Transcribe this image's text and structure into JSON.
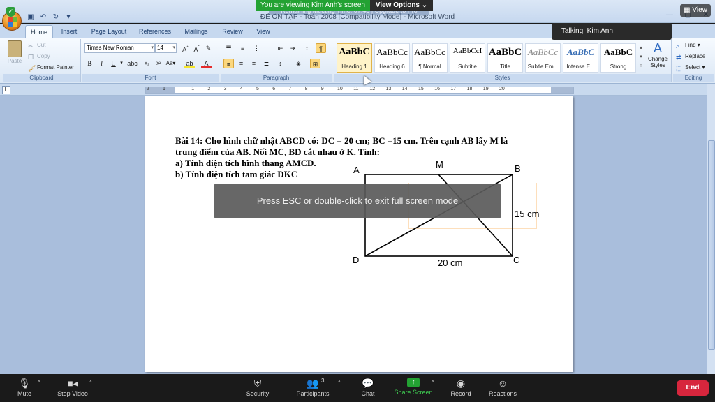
{
  "zoom": {
    "viewing_banner": "You are viewing Kim Anh's screen",
    "view_options_label": "View Options ⌄",
    "meeting_title": "Remaining Meeting Time: 07:48 | Upgrade to Pro",
    "view_button": "View",
    "talking": "Talking: Kim Anh",
    "esc_message": "Press ESC or double-click to exit full screen mode",
    "toolbar": {
      "mute": "Mute",
      "stop_video": "Stop Video",
      "security": "Security",
      "participants": "Participants",
      "participants_count": "3",
      "chat": "Chat",
      "share_screen": "Share Screen",
      "record": "Record",
      "reactions": "Reactions",
      "end": "End"
    },
    "colors": {
      "share_green": "#23a233",
      "end_red": "#d7263d"
    }
  },
  "word": {
    "doc_title": "ĐỀ ÔN TẬP - Toán 2008 [Compatibility Mode] - Microsoft Word",
    "tabs": [
      "Home",
      "Insert",
      "Page Layout",
      "References",
      "Mailings",
      "Review",
      "View"
    ],
    "active_tab": "Home",
    "clipboard": {
      "paste": "Paste",
      "cut": "Cut",
      "copy": "Copy",
      "format_painter": "Format Painter",
      "label": "Clipboard"
    },
    "font": {
      "name": "Times New Roman",
      "size": "14",
      "label": "Font"
    },
    "paragraph_label": "Paragraph",
    "styles": [
      {
        "sample": "AaBbC",
        "name": "Heading 1"
      },
      {
        "sample": "AaBbCc",
        "name": "Heading 6"
      },
      {
        "sample": "AaBbCc",
        "name": "¶ Normal"
      },
      {
        "sample": "AaBbCcI",
        "name": "Subtitle"
      },
      {
        "sample": "AaBbC",
        "name": "Title"
      },
      {
        "sample": "AaBbCc",
        "name": "Subtle Em..."
      },
      {
        "sample": "AaBbC",
        "name": "Intense E..."
      },
      {
        "sample": "AaBbC",
        "name": "Strong"
      }
    ],
    "styles_label": "Styles",
    "change_styles": "Change Styles",
    "editing": {
      "find": "Find",
      "replace": "Replace",
      "select": "Select",
      "label": "Editing"
    },
    "ruler_numbers": [
      "1",
      "2",
      "1",
      "2",
      "3",
      "4",
      "5",
      "6",
      "7",
      "8",
      "9",
      "10",
      "11",
      "12",
      "13",
      "14",
      "15",
      "16",
      "17",
      "18",
      "19",
      "20"
    ]
  },
  "document": {
    "lines": [
      "Bài  14:  Cho hình chữ nhật ABCD có:  DC = 20 cm; BC =15 cm. Trên cạnh AB lấy M là",
      "trung điểm của AB. Nối MC, BD cắt nhau ở K. Tính:",
      "a) Tính diện tích hình thang AMCD.",
      "b) Tính diện tích tam giác DKC"
    ],
    "figure": {
      "labels": {
        "A": "A",
        "B": "B",
        "C": "C",
        "D": "D",
        "M": "M"
      },
      "side_bc": "15 cm",
      "side_dc": "20 cm"
    }
  }
}
